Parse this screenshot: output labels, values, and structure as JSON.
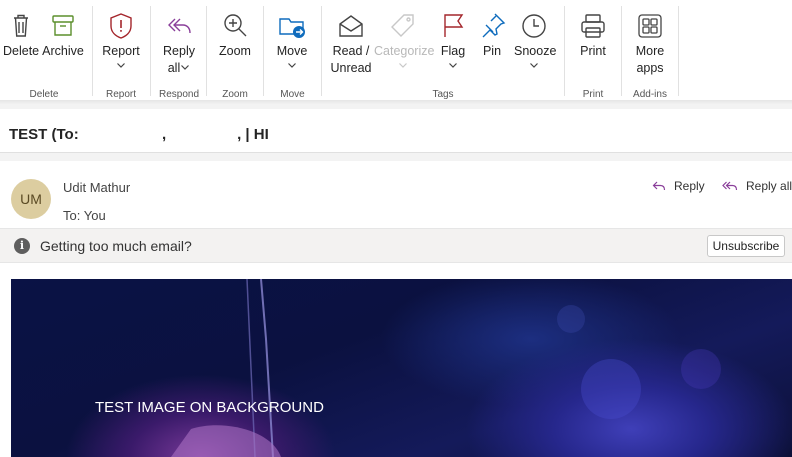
{
  "ribbon": {
    "groups": {
      "delete": {
        "label": "Delete",
        "buttons": {
          "delete": "Delete",
          "archive": "Archive"
        }
      },
      "report": {
        "label": "Report",
        "buttons": {
          "report": "Report"
        }
      },
      "respond": {
        "label": "Respond",
        "buttons": {
          "reply_all_line1": "Reply",
          "reply_all_line2": "all"
        }
      },
      "zoom": {
        "label": "Zoom",
        "buttons": {
          "zoom": "Zoom"
        }
      },
      "move": {
        "label": "Move",
        "buttons": {
          "move": "Move"
        }
      },
      "tags": {
        "label": "Tags",
        "buttons": {
          "read_unread_line1": "Read /",
          "read_unread_line2": "Unread",
          "categorize": "Categorize",
          "flag": "Flag",
          "pin": "Pin",
          "snooze": "Snooze"
        }
      },
      "print": {
        "label": "Print",
        "buttons": {
          "print": "Print"
        }
      },
      "addins": {
        "label": "Add-ins",
        "buttons": {
          "more_apps_line1": "More",
          "more_apps_line2": "apps"
        }
      }
    }
  },
  "message": {
    "subject": "TEST (To:                    ,                 , | HI",
    "sender_initials": "UM",
    "sender_name": "Udit Mathur",
    "to_label": "To:",
    "to_value": "You",
    "reply_label": "Reply",
    "reply_all_label": "Reply all"
  },
  "infobar": {
    "text": "Getting too much email?",
    "unsubscribe_label": "Unsubscribe"
  },
  "body": {
    "hero_text": "TEST IMAGE ON BACKGROUND"
  },
  "colors": {
    "accent_red": "#a4262c",
    "accent_purple": "#8a3f9a",
    "accent_blue": "#0f6cbd",
    "avatar_bg": "#dccda0"
  }
}
